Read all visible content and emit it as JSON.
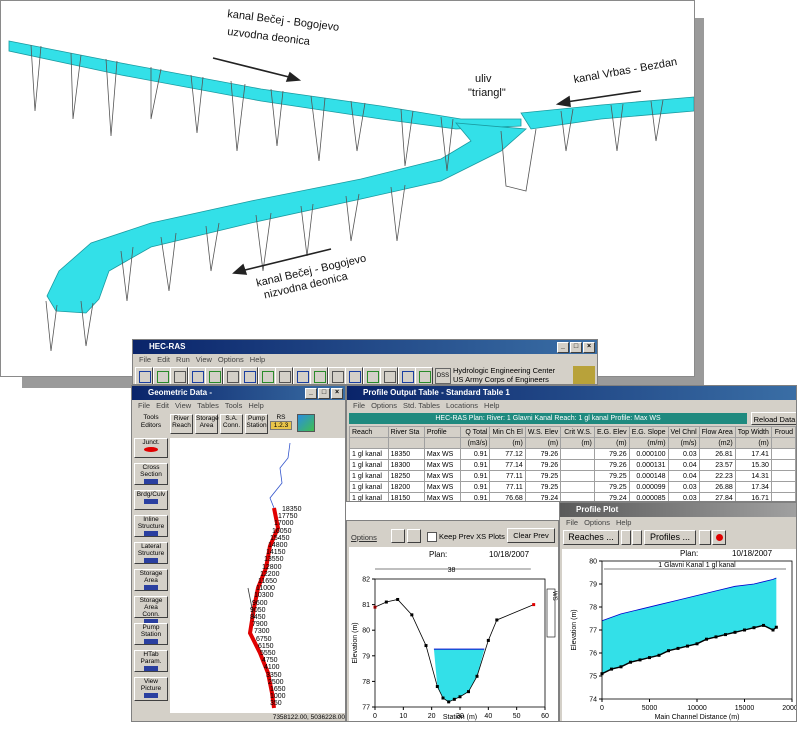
{
  "figure": {
    "label_upstream_line1": "kanal Bečej - Bogojevo",
    "label_upstream_line2": "uzvodna deonica",
    "label_junction_line1": "uliv",
    "label_junction_line2": "\"triangl\"",
    "label_vrbas": "kanal Vrbas - Bezdan",
    "label_downstream_line1": "kanal Bečej - Bogojevo",
    "label_downstream_line2": "nizvodna deonica",
    "water_color": "#33e0e8"
  },
  "hecras": {
    "title": "HEC-RAS",
    "menu": [
      "File",
      "Edit",
      "Run",
      "View",
      "Options",
      "Help"
    ],
    "org_line1": "Hydrologic Engineering Center",
    "org_line2": "US Army Corps of Engineers",
    "dss_label": "DSS"
  },
  "geometric": {
    "title": "Geometric Data -",
    "menu": [
      "File",
      "Edit",
      "View",
      "Tables",
      "Tools",
      "Help"
    ],
    "tools_label": "Tools",
    "editors_label": "Editors",
    "toolbar": [
      {
        "line1": "River",
        "line2": "Reach"
      },
      {
        "line1": "Storage",
        "line2": "Area"
      },
      {
        "line1": "S.A.",
        "line2": "Conn."
      },
      {
        "line1": "Pump",
        "line2": "Station"
      }
    ],
    "rs_label": "RS",
    "rs_value": "1.2.3",
    "editors": [
      {
        "line1": "Junct.",
        "line2": ""
      },
      {
        "line1": "Cross",
        "line2": "Section"
      },
      {
        "line1": "Brdg/Culv",
        "line2": ""
      },
      {
        "line1": "Inline",
        "line2": "Structure"
      },
      {
        "line1": "Lateral",
        "line2": "Structure"
      },
      {
        "line1": "Storage",
        "line2": "Area"
      },
      {
        "line1": "Storage",
        "line2": "Area Conn."
      },
      {
        "line1": "Pump",
        "line2": "Station"
      },
      {
        "line1": "HTab",
        "line2": "Param."
      },
      {
        "line1": "View",
        "line2": "Picture"
      }
    ],
    "stations": [
      "18350",
      "17750",
      "17000",
      "16050",
      "15450",
      "14800",
      "14150",
      "13550",
      "12800",
      "12200",
      "11650",
      "11000",
      "10300",
      "9600",
      "9050",
      "8450",
      "7900",
      "7300",
      "6750",
      "6150",
      "5550",
      "4750",
      "4100",
      "3350",
      "2500",
      "1650",
      "1000",
      "350"
    ],
    "coords": "7358122.00, 5036228.00"
  },
  "profile_table": {
    "title": "Profile Output Table - Standard Table 1",
    "menu": [
      "File",
      "Options",
      "Std. Tables",
      "Locations",
      "Help"
    ],
    "banner": "HEC-RAS  Plan:     River: 1 Glavni Kanal  Reach: 1 gl kanal  Profile: Max WS",
    "reload_label": "Reload Data",
    "headers": [
      "Reach",
      "River Sta",
      "Profile",
      "Q Total",
      "Min Ch El",
      "W.S. Elev",
      "Crit W.S.",
      "E.G. Elev",
      "E.G. Slope",
      "Vel Chnl",
      "Flow Area",
      "Top Width",
      "Froud"
    ],
    "units": [
      "",
      "",
      "",
      "(m3/s)",
      "(m)",
      "(m)",
      "(m)",
      "(m)",
      "(m/m)",
      "(m/s)",
      "(m2)",
      "(m)",
      ""
    ],
    "rows": [
      [
        "1 gl kanal",
        "18350",
        "Max WS",
        "0.91",
        "77.12",
        "79.26",
        "",
        "79.26",
        "0.000100",
        "0.03",
        "26.81",
        "17.41",
        ""
      ],
      [
        "1 gl kanal",
        "18300",
        "Max WS",
        "0.91",
        "77.14",
        "79.26",
        "",
        "79.26",
        "0.000131",
        "0.04",
        "23.57",
        "15.30",
        ""
      ],
      [
        "1 gl kanal",
        "18250",
        "Max WS",
        "0.91",
        "77.11",
        "79.25",
        "",
        "79.25",
        "0.000148",
        "0.04",
        "22.23",
        "14.31",
        ""
      ],
      [
        "1 gl kanal",
        "18200",
        "Max WS",
        "0.91",
        "77.11",
        "79.25",
        "",
        "79.25",
        "0.000099",
        "0.03",
        "26.88",
        "17.34",
        ""
      ],
      [
        "1 gl kanal",
        "18150",
        "Max WS",
        "0.91",
        "76.68",
        "79.24",
        "",
        "79.24",
        "0.000085",
        "0.03",
        "27.84",
        "16.71",
        ""
      ]
    ]
  },
  "xs_plot": {
    "options_label": "Options",
    "keep_prev_label": "Keep Prev XS Plots",
    "clear_prev_label": "Clear Prev",
    "plan_label": "Plan:",
    "date": "10/18/2007",
    "station_label": "38",
    "legend_text": "WS",
    "legend_text2": "Ground",
    "xlabel": "Station (m)",
    "ylabel": "Elevation (m)",
    "water_color": "#33e0e8"
  },
  "profile_plot": {
    "title": "Profile Plot",
    "menu": [
      "File",
      "Options",
      "Help"
    ],
    "reaches_label": "Reaches ...",
    "profiles_label": "Profiles ...",
    "plan_label": "Plan:",
    "date": "10/18/2007",
    "reach_label": "1 Glavni Kanal 1 gl kanal",
    "xlabel": "Main Channel Distance (m)",
    "ylabel": "Elevation (m)",
    "water_color": "#33e0e8"
  },
  "chart_data": [
    {
      "type": "line",
      "name": "cross-section",
      "xlabel": "Station (m)",
      "ylabel": "Elevation (m)",
      "xlim": [
        0,
        60
      ],
      "ylim": [
        77,
        82
      ],
      "xticks": [
        0,
        10,
        20,
        30,
        40,
        50,
        60
      ],
      "yticks": [
        77,
        78,
        79,
        80,
        81,
        82
      ],
      "ground_x": [
        0,
        4,
        8,
        13,
        18,
        22,
        24,
        26,
        28,
        30,
        33,
        36,
        40,
        43,
        56
      ],
      "ground_y": [
        80.9,
        81.1,
        81.2,
        80.6,
        79.4,
        77.8,
        77.35,
        77.2,
        77.3,
        77.4,
        77.6,
        78.2,
        79.6,
        80.4,
        81.0
      ],
      "water_surface": 79.26,
      "water_x": [
        20.8,
        38.6
      ]
    },
    {
      "type": "line",
      "name": "profile",
      "xlabel": "Main Channel Distance (m)",
      "ylabel": "Elevation (m)",
      "xlim": [
        0,
        20000
      ],
      "ylim": [
        74,
        80
      ],
      "xticks": [
        0,
        5000,
        10000,
        15000,
        20000
      ],
      "yticks": [
        74,
        75,
        76,
        77,
        78,
        79,
        80
      ],
      "ws_x": [
        0,
        2000,
        4000,
        6000,
        8000,
        10000,
        12000,
        14000,
        16000,
        18000,
        18350
      ],
      "ws_y": [
        77.4,
        77.7,
        77.9,
        78.1,
        78.3,
        78.5,
        78.7,
        78.9,
        79.0,
        79.2,
        79.26
      ],
      "bed_x": [
        0,
        1000,
        2000,
        3000,
        4000,
        5000,
        6000,
        7000,
        8000,
        9000,
        10000,
        11000,
        12000,
        13000,
        14000,
        15000,
        16000,
        17000,
        18000,
        18350
      ],
      "bed_y": [
        75.1,
        75.3,
        75.4,
        75.6,
        75.7,
        75.8,
        75.9,
        76.1,
        76.2,
        76.3,
        76.4,
        76.6,
        76.7,
        76.8,
        76.9,
        77.0,
        77.1,
        77.2,
        77.0,
        77.12
      ]
    }
  ]
}
